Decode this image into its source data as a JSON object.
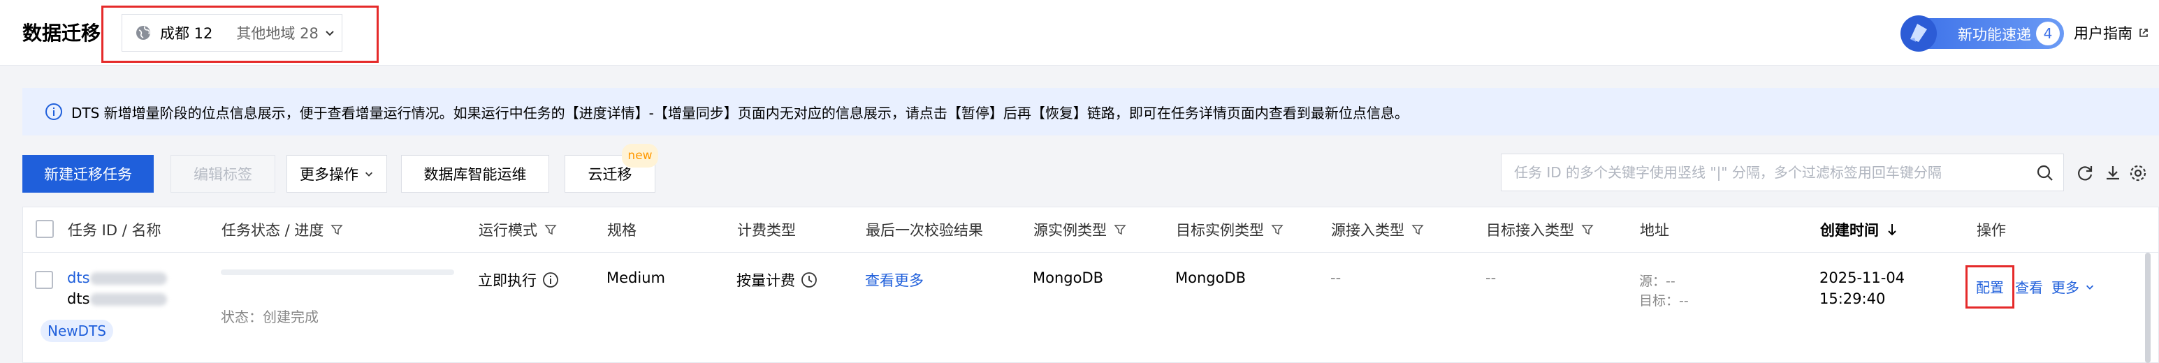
{
  "header": {
    "title": "数据迁移",
    "region_current": "成都 12",
    "region_other": "其他地域 28",
    "feature_label": "新功能速递",
    "feature_count": "4",
    "guide_label": "用户指南"
  },
  "notice": {
    "text": "DTS 新增增量阶段的位点信息展示，便于查看增量运行情况。如果运行中任务的【进度详情】-【增量同步】页面内无对应的信息展示，请点击【暂停】后再【恢复】链路，即可在任务详情页面内查看到最新位点信息。"
  },
  "toolbar": {
    "create_label": "新建迁移任务",
    "edit_tags_label": "编辑标签",
    "more_ops_label": "更多操作",
    "db_ops_label": "数据库智能运维",
    "cloud_migrate_label": "云迁移",
    "new_badge": "new",
    "search_placeholder": "任务 ID 的多个关键字使用竖线 \"|\" 分隔，多个过滤标签用回车键分隔"
  },
  "table": {
    "columns": [
      "任务 ID / 名称",
      "任务状态 / 进度",
      "运行模式",
      "规格",
      "计费类型",
      "最后一次校验结果",
      "源实例类型",
      "目标实例类型",
      "源接入类型",
      "目标接入类型",
      "地址",
      "创建时间",
      "操作"
    ],
    "rows": [
      {
        "id_prefix": "dts",
        "name_prefix": "dts",
        "tag": "NewDTS",
        "status": "状态：创建完成",
        "run_mode": "立即执行",
        "spec": "Medium",
        "billing": "按量计费",
        "check_result": "查看更多",
        "source_type": "MongoDB",
        "target_type": "MongoDB",
        "source_access": "--",
        "target_access": "--",
        "addr_source": "源：--",
        "addr_target": "目标：--",
        "created_date": "2025-11-04",
        "created_time": "15:29:40",
        "action_config": "配置",
        "action_view": "查看",
        "action_more": "更多"
      }
    ]
  },
  "colors": {
    "primary": "#1f5fdb",
    "highlight": "#e52a2a",
    "notice_bg": "#e9f0ff"
  }
}
